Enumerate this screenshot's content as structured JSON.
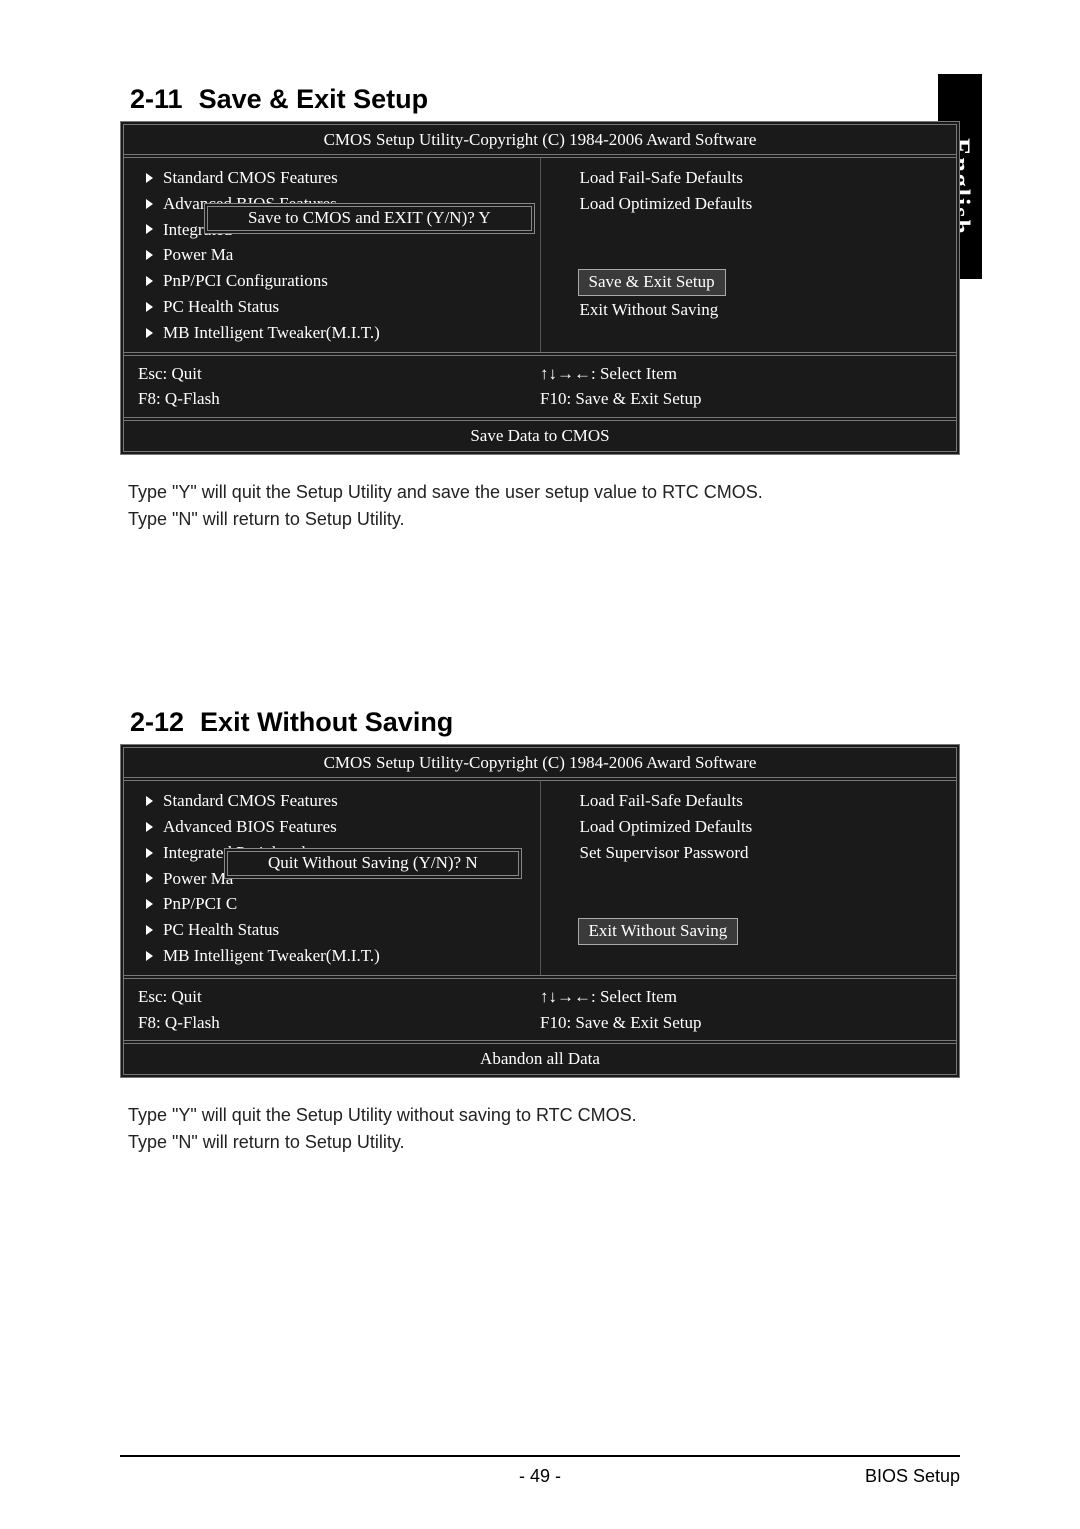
{
  "sideTab": "English",
  "section1": {
    "num": "2-11",
    "title": "Save & Exit Setup"
  },
  "section2": {
    "num": "2-12",
    "title": "Exit Without Saving"
  },
  "biosTitle": "CMOS Setup Utility-Copyright (C) 1984-2006 Award Software",
  "box1": {
    "left": [
      "Standard CMOS Features",
      "Advanced BIOS Features",
      "Integrated",
      "Power Ma",
      "PnP/PCI Configurations",
      "PC Health Status",
      "MB Intelligent Tweaker(M.I.T.)"
    ],
    "right": [
      "Load Fail-Safe Defaults",
      "Load Optimized Defaults",
      "",
      "",
      "Save & Exit Setup",
      "Exit Without Saving"
    ],
    "highlightIdx": 4,
    "dialog": "Save to CMOS and EXIT (Y/N)? Y",
    "hint": "Save Data to CMOS"
  },
  "box2": {
    "left": [
      "Standard CMOS Features",
      "Advanced BIOS Features",
      "Integrated Peripherals",
      "Power Ma",
      "PnP/PCI C",
      "PC Health Status",
      "MB Intelligent Tweaker(M.I.T.)"
    ],
    "right": [
      "Load Fail-Safe Defaults",
      "Load Optimized Defaults",
      "Set Supervisor Password",
      "",
      "",
      "Exit Without Saving"
    ],
    "highlightIdx": 5,
    "dialog": "Quit Without Saving (Y/N)? N",
    "hint": "Abandon all Data"
  },
  "footerKeys": {
    "esc": "Esc: Quit",
    "f8": "F8: Q-Flash",
    "arrows": "↑↓→←: Select Item",
    "f10": "F10: Save & Exit Setup"
  },
  "bodyText1a": "Type \"Y\" will quit the Setup Utility and save the user setup value to RTC CMOS.",
  "bodyText1b": "Type \"N\" will return to Setup Utility.",
  "bodyText2a": "Type \"Y\" will quit the Setup Utility without saving to RTC CMOS.",
  "bodyText2b": "Type \"N\" will return to Setup Utility.",
  "pageNum": "- 49 -",
  "pageLabel": "BIOS Setup"
}
